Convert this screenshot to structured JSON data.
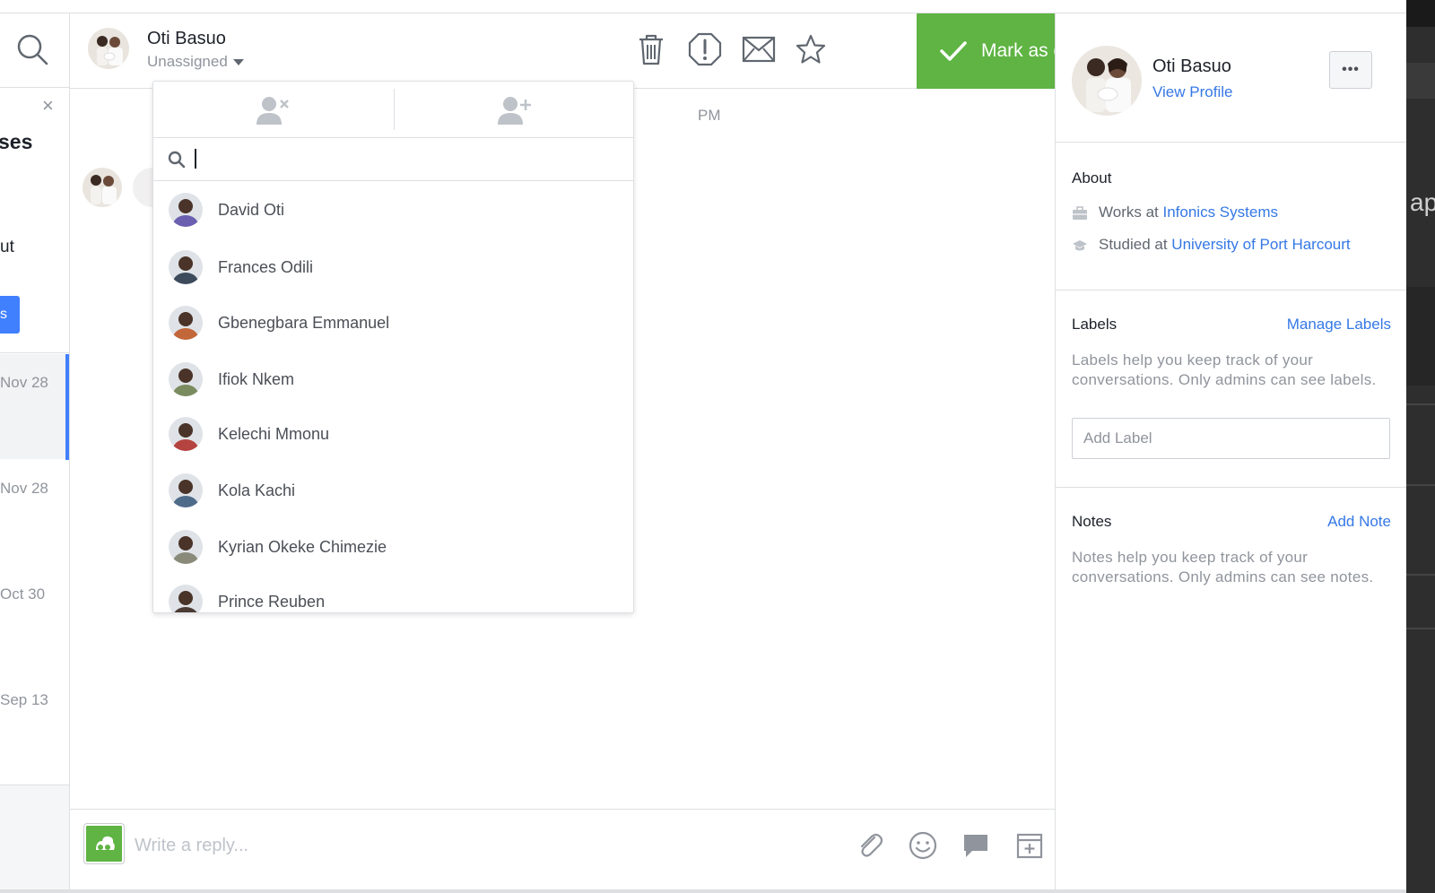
{
  "header": {
    "contact_name": "Oti Basuo",
    "assignment": "Unassigned",
    "mark_done_label": "Mark as done"
  },
  "left_panel": {
    "promo_title_fragment": "ses",
    "promo_text_fragment": "ut",
    "promo_button_fragment": "s",
    "conversations": [
      {
        "date": "Nov 28",
        "selected": true
      },
      {
        "date": "Nov 28",
        "selected": false
      },
      {
        "date": "Oct 30",
        "selected": false
      },
      {
        "date": "Sep 13",
        "selected": false
      }
    ]
  },
  "conversation": {
    "timestamp_fragment": "PM",
    "bubble_fragment": "("
  },
  "composer": {
    "placeholder": "Write a reply..."
  },
  "assign_dropdown": {
    "search_value": "",
    "people": [
      {
        "name": "David Oti",
        "color": "#6b5fb0"
      },
      {
        "name": "Frances Odili",
        "color": "#3d4a5c"
      },
      {
        "name": "Gbenegbara Emmanuel",
        "color": "#c2673a"
      },
      {
        "name": "Ifiok Nkem",
        "color": "#7a8c5f"
      },
      {
        "name": "Kelechi Mmonu",
        "color": "#b5433f"
      },
      {
        "name": "Kola Kachi",
        "color": "#4f6b8a"
      },
      {
        "name": "Kyrian Okeke Chimezie",
        "color": "#8a8a7a"
      },
      {
        "name": "Prince Reuben",
        "color": "#4a3b34"
      }
    ]
  },
  "profile": {
    "name": "Oti Basuo",
    "view_profile": "View Profile",
    "about_title": "About",
    "works_prefix": "Works at",
    "works_org": "Infonics Systems",
    "studied_prefix": "Studied at",
    "studied_org": "University of Port Harcourt",
    "labels_title": "Labels",
    "manage_labels": "Manage Labels",
    "labels_desc": "Labels help you keep track of your conversations. Only admins can see labels.",
    "add_label_placeholder": "Add Label",
    "notes_title": "Notes",
    "add_note": "Add Note",
    "notes_desc": "Notes help you keep track of your conversations. Only admins can see notes."
  },
  "edge": {
    "text_fragment": "ap"
  },
  "colors": {
    "accent_green": "#5fb443",
    "link_blue": "#3578e5",
    "selected_indicator": "#4080ff"
  }
}
